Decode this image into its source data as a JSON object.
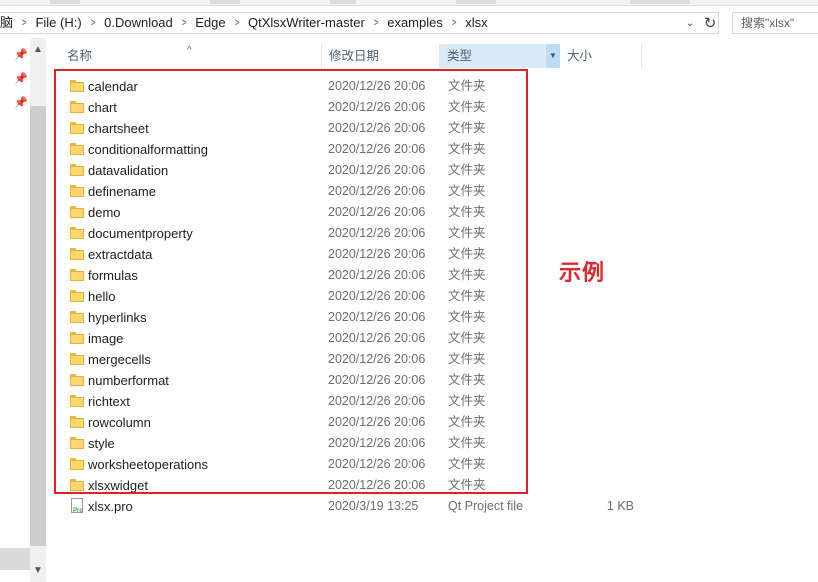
{
  "breadcrumb": [
    "脑",
    "File (H:)",
    "0.Download",
    "Edge",
    "QtXlsxWriter-master",
    "examples",
    "xlsx"
  ],
  "address_dropdown_icon": "chevron-down-icon",
  "refresh_icon": "refresh-icon",
  "search_placeholder": "搜索\"xlsx\"",
  "columns": {
    "name": "名称",
    "date": "修改日期",
    "type": "类型",
    "size": "大小"
  },
  "files": [
    {
      "name": "calendar",
      "date": "2020/12/26 20:06",
      "type": "文件夹",
      "size": "",
      "icon": "folder-icon"
    },
    {
      "name": "chart",
      "date": "2020/12/26 20:06",
      "type": "文件夹",
      "size": "",
      "icon": "folder-icon"
    },
    {
      "name": "chartsheet",
      "date": "2020/12/26 20:06",
      "type": "文件夹",
      "size": "",
      "icon": "folder-icon"
    },
    {
      "name": "conditionalformatting",
      "date": "2020/12/26 20:06",
      "type": "文件夹",
      "size": "",
      "icon": "folder-icon"
    },
    {
      "name": "datavalidation",
      "date": "2020/12/26 20:06",
      "type": "文件夹",
      "size": "",
      "icon": "folder-icon"
    },
    {
      "name": "definename",
      "date": "2020/12/26 20:06",
      "type": "文件夹",
      "size": "",
      "icon": "folder-icon"
    },
    {
      "name": "demo",
      "date": "2020/12/26 20:06",
      "type": "文件夹",
      "size": "",
      "icon": "folder-icon"
    },
    {
      "name": "documentproperty",
      "date": "2020/12/26 20:06",
      "type": "文件夹",
      "size": "",
      "icon": "folder-icon"
    },
    {
      "name": "extractdata",
      "date": "2020/12/26 20:06",
      "type": "文件夹",
      "size": "",
      "icon": "folder-icon"
    },
    {
      "name": "formulas",
      "date": "2020/12/26 20:06",
      "type": "文件夹",
      "size": "",
      "icon": "folder-icon"
    },
    {
      "name": "hello",
      "date": "2020/12/26 20:06",
      "type": "文件夹",
      "size": "",
      "icon": "folder-icon"
    },
    {
      "name": "hyperlinks",
      "date": "2020/12/26 20:06",
      "type": "文件夹",
      "size": "",
      "icon": "folder-icon"
    },
    {
      "name": "image",
      "date": "2020/12/26 20:06",
      "type": "文件夹",
      "size": "",
      "icon": "folder-icon"
    },
    {
      "name": "mergecells",
      "date": "2020/12/26 20:06",
      "type": "文件夹",
      "size": "",
      "icon": "folder-icon"
    },
    {
      "name": "numberformat",
      "date": "2020/12/26 20:06",
      "type": "文件夹",
      "size": "",
      "icon": "folder-icon"
    },
    {
      "name": "richtext",
      "date": "2020/12/26 20:06",
      "type": "文件夹",
      "size": "",
      "icon": "folder-icon"
    },
    {
      "name": "rowcolumn",
      "date": "2020/12/26 20:06",
      "type": "文件夹",
      "size": "",
      "icon": "folder-icon"
    },
    {
      "name": "style",
      "date": "2020/12/26 20:06",
      "type": "文件夹",
      "size": "",
      "icon": "folder-icon"
    },
    {
      "name": "worksheetoperations",
      "date": "2020/12/26 20:06",
      "type": "文件夹",
      "size": "",
      "icon": "folder-icon"
    },
    {
      "name": "xlsxwidget",
      "date": "2020/12/26 20:06",
      "type": "文件夹",
      "size": "",
      "icon": "folder-icon"
    },
    {
      "name": "xlsx.pro",
      "date": "2020/3/19 13:25",
      "type": "Qt Project file",
      "size": "1 KB",
      "icon": "qt-project-file-icon"
    }
  ],
  "annotation": "示例",
  "colors": {
    "highlight_border": "#e0202a",
    "annotation_text": "#e3262d",
    "active_column": "#d9ebf9",
    "folder": "#ffd76e"
  }
}
